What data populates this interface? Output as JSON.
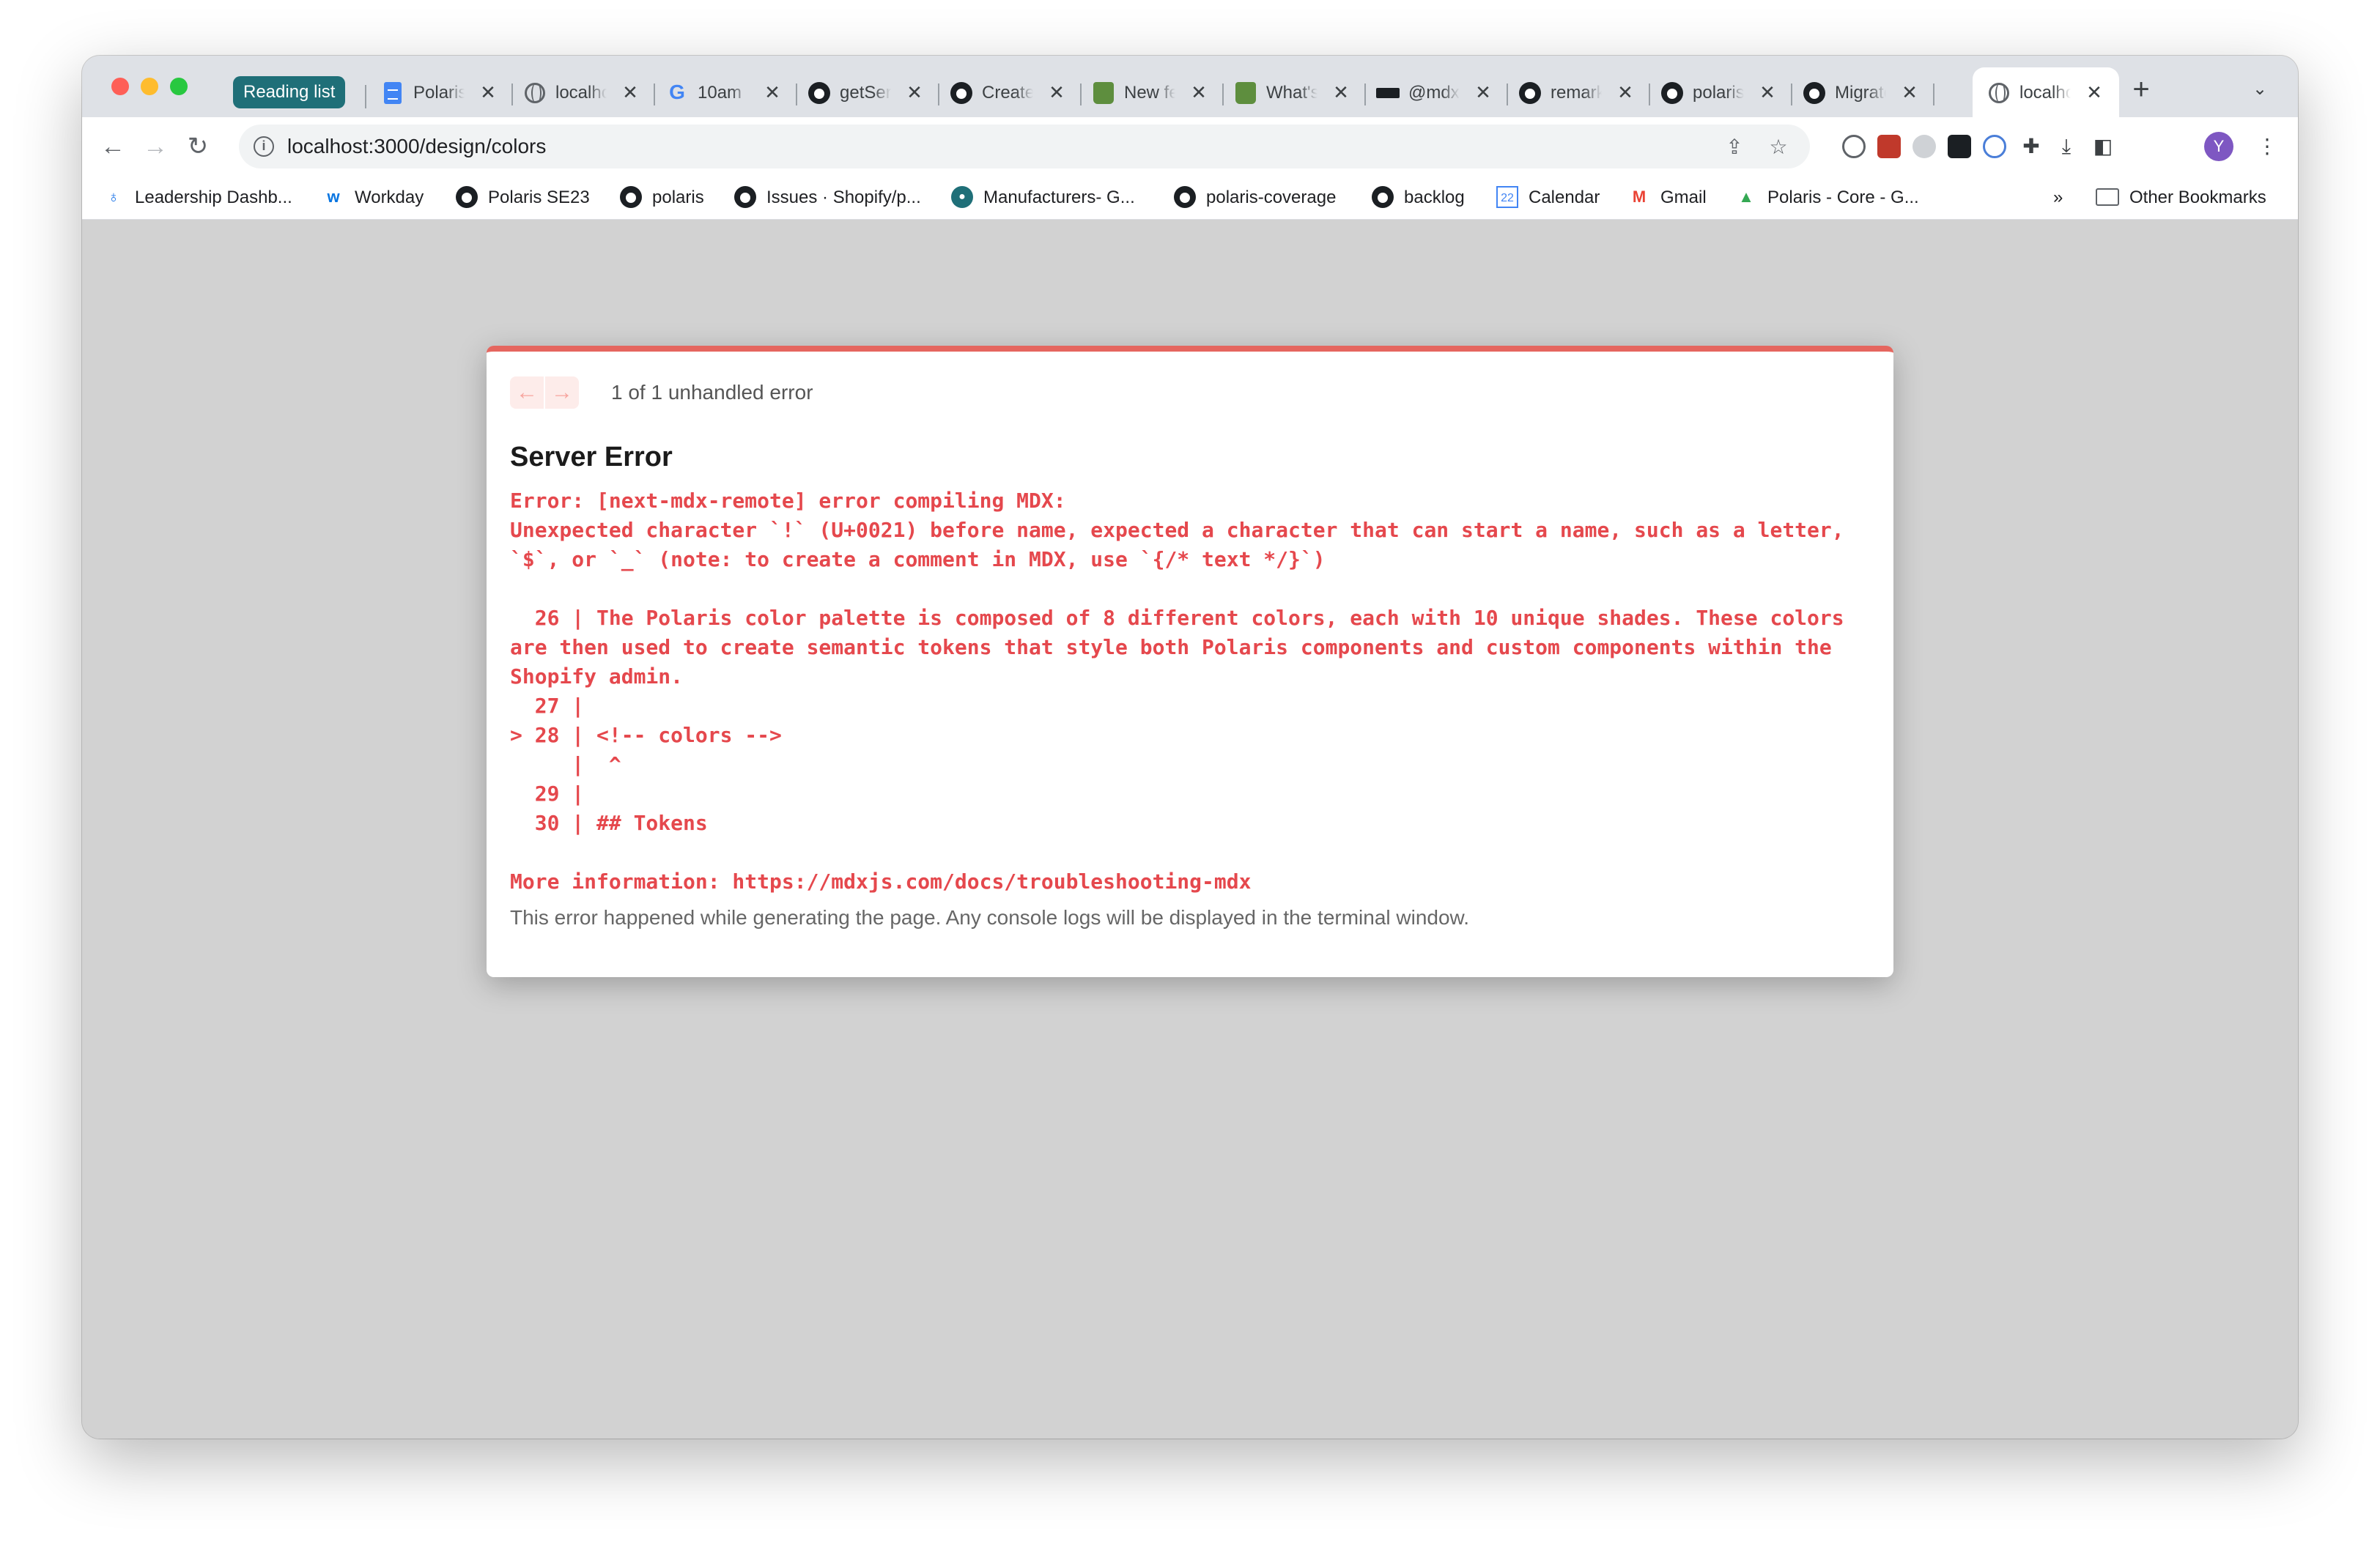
{
  "tabs": {
    "reading_list": "Reading list",
    "items": [
      {
        "title": "Polaris",
        "icon": "google-docs-icon"
      },
      {
        "title": "localhost",
        "icon": "globe-icon"
      },
      {
        "title": "10am",
        "icon": "google-icon"
      },
      {
        "title": "getServerSideProps",
        "icon": "github-icon"
      },
      {
        "title": "Create",
        "icon": "github-icon"
      },
      {
        "title": "New feature",
        "icon": "shopify-icon"
      },
      {
        "title": "What's",
        "icon": "shopify-icon"
      },
      {
        "title": "@mdx",
        "icon": "mdx-icon"
      },
      {
        "title": "remark",
        "icon": "github-icon"
      },
      {
        "title": "polaris",
        "icon": "github-icon"
      },
      {
        "title": "Migrate",
        "icon": "github-icon"
      },
      {
        "title": "localhost",
        "icon": "globe-icon"
      }
    ],
    "close_glyph": "✕",
    "new_tab_glyph": "+",
    "tab_search_glyph": "⌄"
  },
  "toolbar": {
    "url": "localhost:3000/design/colors",
    "avatar_letter": "Y"
  },
  "bookmarks": [
    {
      "label": "Leadership Dashb...",
      "icon": "leadership-icon"
    },
    {
      "label": "Workday",
      "icon": "workday-icon"
    },
    {
      "label": "Polaris SE23",
      "icon": "github-icon"
    },
    {
      "label": "polaris",
      "icon": "github-icon"
    },
    {
      "label": "Issues · Shopify/p...",
      "icon": "github-icon"
    },
    {
      "label": "Manufacturers- G...",
      "icon": "pin-icon"
    },
    {
      "label": "polaris-coverage",
      "icon": "github-icon"
    },
    {
      "label": "backlog",
      "icon": "github-icon"
    },
    {
      "label": "Calendar",
      "icon": "calendar-icon"
    },
    {
      "label": "Gmail",
      "icon": "gmail-icon"
    },
    {
      "label": "Polaris - Core - G...",
      "icon": "drive-icon"
    }
  ],
  "bookmarks_overflow": "»",
  "other_bookmarks": "Other Bookmarks",
  "error": {
    "count": "1 of 1 unhandled error",
    "title": "Server Error",
    "body_lines": [
      "Error: [next-mdx-remote] error compiling MDX:",
      "Unexpected character `!` (U+0021) before name, expected a character that can start a name, such as a letter,",
      "`$`, or `_` (note: to create a comment in MDX, use `{/* text */}`)",
      "",
      "  26 | The Polaris color palette is composed of 8 different colors, each with 10 unique shades. These colors",
      "are then used to create semantic tokens that style both Polaris components and custom components within the",
      "Shopify admin.",
      "  27 |",
      "> 28 | <!-- colors -->",
      "     |  ^",
      "  29 |",
      "  30 | ## Tokens",
      "",
      "More information: https://mdxjs.com/docs/troubleshooting-mdx"
    ],
    "footer": "This error happened while generating the page. Any console logs will be displayed in the terminal window."
  }
}
